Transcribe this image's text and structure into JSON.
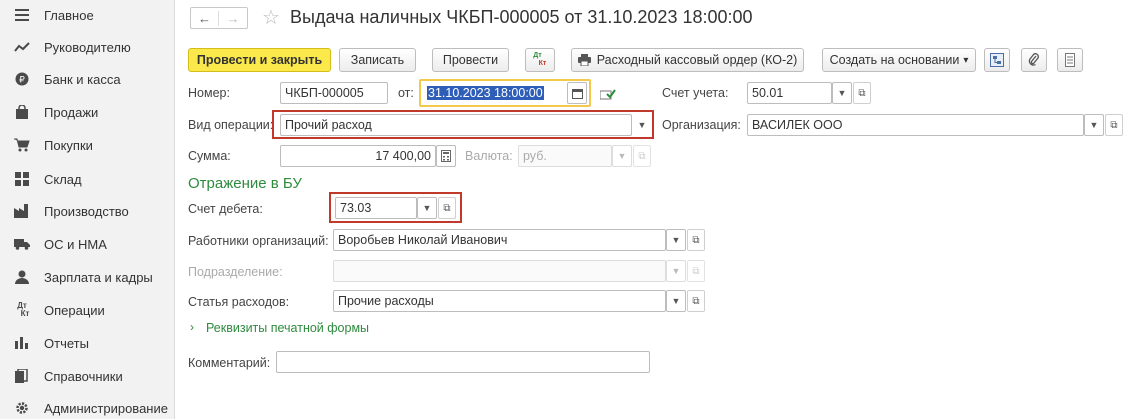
{
  "sidebar": {
    "items": [
      {
        "label": "Главное",
        "icon": "menu-icon"
      },
      {
        "label": "Руководителю",
        "icon": "trend-icon"
      },
      {
        "label": "Банк и касса",
        "icon": "coin-icon"
      },
      {
        "label": "Продажи",
        "icon": "bag-icon"
      },
      {
        "label": "Покупки",
        "icon": "cart-icon"
      },
      {
        "label": "Склад",
        "icon": "grid-icon"
      },
      {
        "label": "Производство",
        "icon": "factory-icon"
      },
      {
        "label": "ОС и НМА",
        "icon": "truck-icon"
      },
      {
        "label": "Зарплата и кадры",
        "icon": "person-icon"
      },
      {
        "label": "Операции",
        "icon": "dt-kt-icon"
      },
      {
        "label": "Отчеты",
        "icon": "bar-chart-icon"
      },
      {
        "label": "Справочники",
        "icon": "books-icon"
      },
      {
        "label": "Администрирование",
        "icon": "gear-icon"
      }
    ]
  },
  "header": {
    "back": "←",
    "forward": "→",
    "star": "☆",
    "title": "Выдача наличных ЧКБП-000005 от 31.10.2023 18:00:00"
  },
  "toolbar": {
    "post_close": "Провести и закрыть",
    "save": "Записать",
    "post": "Провести",
    "dtkt_top": "Дт",
    "dtkt_bottom": "Кт",
    "print_order": "Расходный кассовый ордер (КО-2)",
    "create_based": "Создать на основании",
    "dropdown_arrow": "▾"
  },
  "form": {
    "number_label": "Номер:",
    "number_value": "ЧКБП-000005",
    "date_label": "от:",
    "date_value": "31.10.2023 18:00:00",
    "account_label": "Счет учета:",
    "account_value": "50.01",
    "operation_label": "Вид операции:",
    "operation_value": "Прочий расход",
    "org_label": "Организация:",
    "org_value": "ВАСИЛЕК ООО",
    "sum_label": "Сумма:",
    "sum_value": "17 400,00",
    "currency_label": "Валюта:",
    "currency_value": "руб.",
    "section_title": "Отражение в БУ",
    "debit_label": "Счет дебета:",
    "debit_value": "73.03",
    "employees_label": "Работники организаций:",
    "employees_value": "Воробьев Николай Иванович",
    "department_label": "Подразделение:",
    "department_value": "",
    "expense_label": "Статья расходов:",
    "expense_value": "Прочие расходы",
    "print_details_link": "Реквизиты печатной формы",
    "comment_label": "Комментарий:",
    "comment_value": ""
  },
  "colors": {
    "primary_button": "#fbe84b",
    "highlight_border": "#c0392b",
    "section_green": "#2e8b3e"
  }
}
